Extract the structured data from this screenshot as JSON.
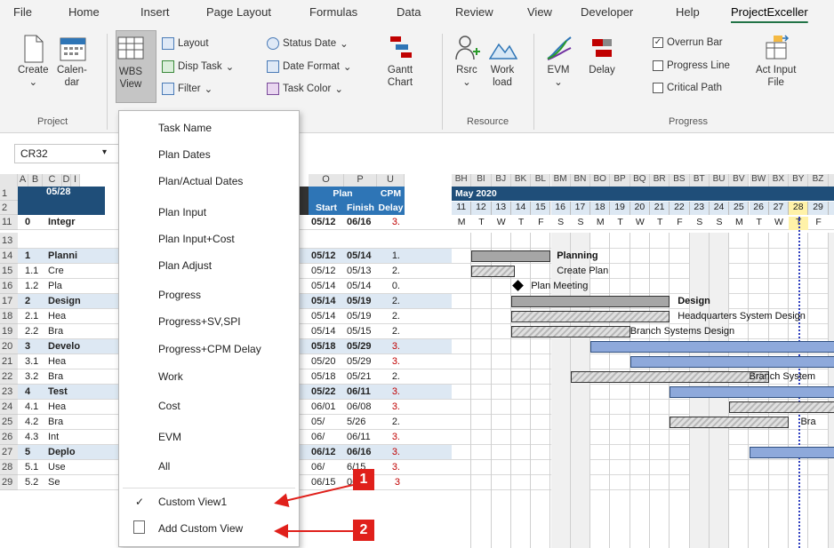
{
  "menubar": {
    "items": [
      "File",
      "Home",
      "Insert",
      "Page Layout",
      "Formulas",
      "Data",
      "Review",
      "View",
      "Developer",
      "Help",
      "ProjectExceller"
    ]
  },
  "ribbon": {
    "create_label": "Create",
    "calendar_label": "Calen-\ndar",
    "wbs_view_label": "WBS\nView",
    "layout_label": "Layout",
    "disp_task_label": "Disp Task",
    "filter_label": "Filter",
    "status_date_label": "Status Date",
    "date_format_label": "Date Format",
    "task_color_label": "Task Color",
    "gantt_chart_label": "Gantt\nChart",
    "rsrc_label": "Rsrc",
    "workload_label": "Work\nload",
    "evm_label": "EVM",
    "delay_label": "Delay",
    "overrun_bar_label": "Overrun Bar",
    "progress_line_label": "Progress Line",
    "critical_path_label": "Critical Path",
    "act_input_label": "Act Input\nFile",
    "groups": {
      "project": "Project",
      "resource": "Resource",
      "progress": "Progress"
    },
    "overrun_checked_mark": "✓"
  },
  "formula_bar": {
    "name_box": "CR32",
    "dropdown": "▾"
  },
  "columns": {
    "row_head": "",
    "left": [
      "A",
      "B",
      "C",
      "D",
      "I"
    ],
    "mid": [
      "O",
      "P",
      "U"
    ],
    "gantt": [
      "BH",
      "BI",
      "BJ",
      "BK",
      "BL",
      "BM",
      "BN",
      "BO",
      "BP",
      "BQ",
      "BR",
      "BS",
      "BT",
      "BU",
      "BV",
      "BW",
      "BX",
      "BY",
      "BZ",
      "C"
    ]
  },
  "header": {
    "date_cell": "05/28",
    "plan": "Plan",
    "start": "Start",
    "finish": "Finish",
    "cpm": "CPM",
    "delay": "Delay",
    "month": "May 2020",
    "days": [
      "11",
      "12",
      "13",
      "14",
      "15",
      "16",
      "17",
      "18",
      "19",
      "20",
      "21",
      "22",
      "23",
      "24",
      "25",
      "26",
      "27",
      "28",
      "29",
      "3"
    ],
    "weekdays": [
      "M",
      "T",
      "W",
      "T",
      "F",
      "S",
      "S",
      "M",
      "T",
      "W",
      "T",
      "F",
      "S",
      "S",
      "M",
      "T",
      "W",
      "T",
      "F",
      "S"
    ]
  },
  "rows": [
    {
      "rn": "1",
      "b": "",
      "c": "05/28",
      "o": "",
      "p": "",
      "u": ""
    },
    {
      "rn": "2",
      "b": "",
      "c": "",
      "o": "",
      "p": "",
      "u": ""
    },
    {
      "rn": "11",
      "b": "0",
      "c": "Integr",
      "o": "05/12",
      "p": "06/16",
      "u": "3."
    },
    {
      "rn": "13",
      "b": "",
      "c": "",
      "o": "",
      "p": "",
      "u": ""
    },
    {
      "rn": "14",
      "b": "1",
      "c": "Planni",
      "o": "05/12",
      "p": "05/14",
      "u": "1."
    },
    {
      "rn": "15",
      "b": "1.1",
      "c": "Cre",
      "o": "05/12",
      "p": "05/13",
      "u": "2."
    },
    {
      "rn": "16",
      "b": "1.2",
      "c": "Pla",
      "o": "05/14",
      "p": "05/14",
      "u": "0."
    },
    {
      "rn": "17",
      "b": "2",
      "c": "Design",
      "o": "05/14",
      "p": "05/19",
      "u": "2."
    },
    {
      "rn": "18",
      "b": "2.1",
      "c": "Hea",
      "o": "05/14",
      "p": "05/19",
      "u": "2."
    },
    {
      "rn": "19",
      "b": "2.2",
      "c": "Bra",
      "o": "05/14",
      "p": "05/15",
      "u": "2."
    },
    {
      "rn": "20",
      "b": "3",
      "c": "Develo",
      "o": "05/18",
      "p": "05/29",
      "u": "3."
    },
    {
      "rn": "21",
      "b": "3.1",
      "c": "Hea",
      "o": "05/20",
      "p": "05/29",
      "u": "3."
    },
    {
      "rn": "22",
      "b": "3.2",
      "c": "Bra",
      "o": "05/18",
      "p": "05/21",
      "u": "2."
    },
    {
      "rn": "23",
      "b": "4",
      "c": "Test",
      "o": "05/22",
      "p": "06/11",
      "u": "3."
    },
    {
      "rn": "24",
      "b": "4.1",
      "c": "Hea",
      "o": "06/01",
      "p": "06/08",
      "u": "3."
    },
    {
      "rn": "25",
      "b": "4.2",
      "c": "Bra",
      "o": "05/",
      "p": "5/26",
      "u": "2."
    },
    {
      "rn": "26",
      "b": "4.3",
      "c": "Int",
      "o": "06/",
      "p": "06/11",
      "u": "3."
    },
    {
      "rn": "27",
      "b": "5",
      "c": "Deplo",
      "o": "06/12",
      "p": "06/16",
      "u": "3."
    },
    {
      "rn": "28",
      "b": "5.1",
      "c": "Use",
      "o": "06/",
      "p": "6/15",
      "u": "3."
    },
    {
      "rn": "29",
      "b": "5.2",
      "c": "Se",
      "o": "06/15",
      "p": "06/16",
      "u": "3"
    }
  ],
  "gantt_labels": {
    "planning": "Planning",
    "create_plan": "Create Plan",
    "plan_meeting": "Plan Meeting",
    "design": "Design",
    "hq_design": "Headquarters System Design",
    "branch_design": "Branch Systems Design",
    "branch_system": "Branch System",
    "bra": "Bra"
  },
  "dropdown_menu": {
    "items": [
      "Task Name",
      "Plan Dates",
      "Plan/Actual Dates",
      "Plan Input",
      "Plan Input+Cost",
      "Plan Adjust",
      "Progress",
      "Progress+SV,SPI",
      "Progress+CPM Delay",
      "Work",
      "Cost",
      "EVM",
      "All",
      "Custom View1",
      "Add Custom View"
    ],
    "check_mark": "✓"
  },
  "callouts": [
    "1",
    "2"
  ],
  "colors": {
    "accent": "#217346",
    "header_blue": "#1f4e79",
    "callout_red": "#e0201b",
    "today": "#fff2a8"
  }
}
